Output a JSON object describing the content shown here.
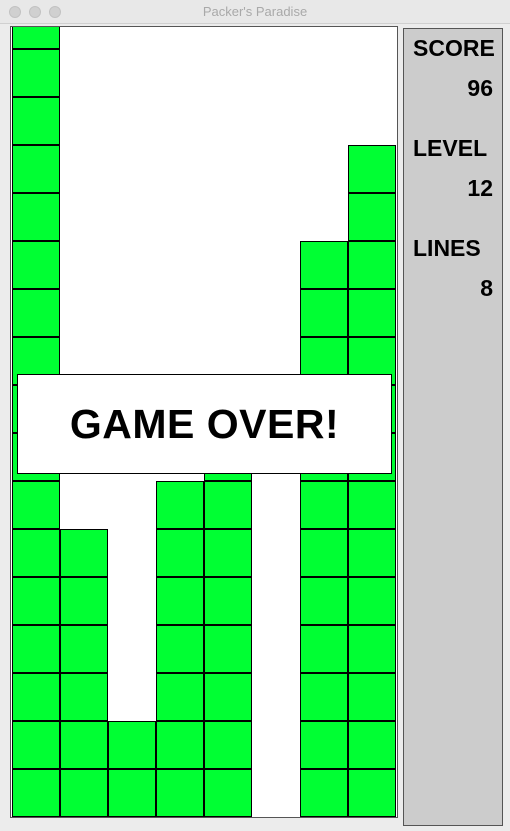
{
  "window": {
    "title": "Packer's Paradise"
  },
  "board": {
    "cell_color": "#00ff33",
    "columns": 8,
    "cell_rows": {
      "col_0_top_row": 0,
      "col_1_top_row": 11,
      "col_2_top_row": 15,
      "col_3_top_row": 10,
      "col_4_top_row": 9,
      "col_5_top_row": null,
      "col_6_top_row": 5,
      "col_7_top_row": 3
    }
  },
  "overlay": {
    "message": "GAME OVER!"
  },
  "panel": {
    "score_label": "SCORE",
    "score_value": "96",
    "level_label": "LEVEL",
    "level_value": "12",
    "lines_label": "LINES",
    "lines_value": "8"
  }
}
